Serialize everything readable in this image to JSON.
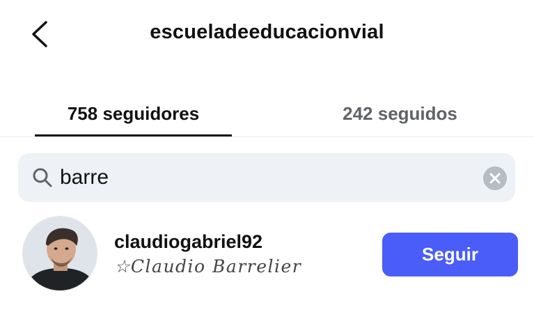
{
  "header": {
    "back_icon": "chevron-left-icon",
    "title": "escueladeeducacionvial"
  },
  "tabs": [
    {
      "label": "758 seguidores",
      "active": true
    },
    {
      "label": "242 seguidos",
      "active": false
    }
  ],
  "search": {
    "icon": "search-icon",
    "value": "barre",
    "clear_icon": "clear-icon"
  },
  "results": [
    {
      "username": "claudiogabriel92",
      "full_name": "☆Claudio Barrelier",
      "button_label": "Seguir"
    }
  ],
  "colors": {
    "follow_button": "#4a5df9",
    "search_background": "#eef1f5",
    "inactive_tab": "#5f6368"
  }
}
